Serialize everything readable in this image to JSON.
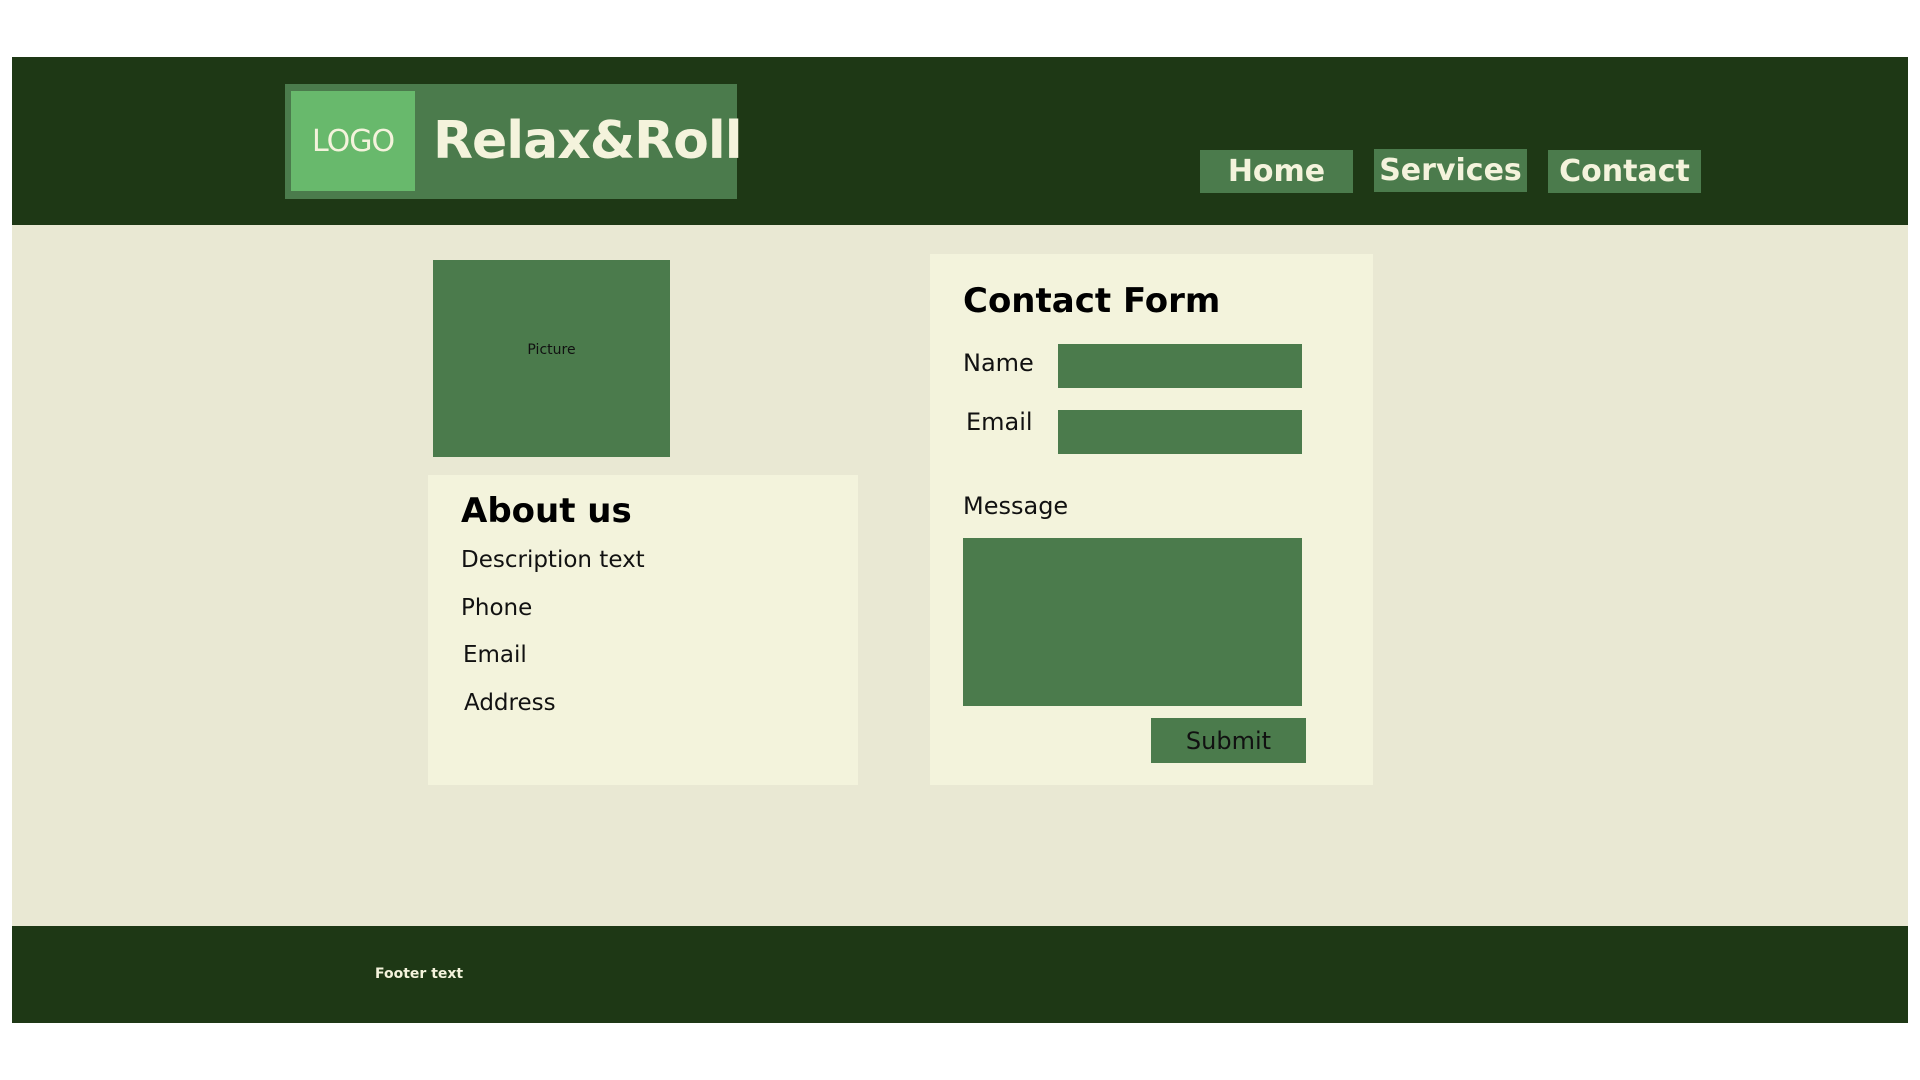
{
  "colors": {
    "header_bg": "#1e3815",
    "accent": "#4b7b4c",
    "logo_bg": "#68b96c",
    "page_bg": "#e9e8d3",
    "panel_bg": "#f3f3dc",
    "light_text": "#f4f3dc"
  },
  "header": {
    "logo_text": "LOGO",
    "brand_name": "Relax&Roll",
    "nav": [
      {
        "label": "Home"
      },
      {
        "label": "Services"
      },
      {
        "label": "Contact"
      }
    ]
  },
  "picture": {
    "label": "Picture"
  },
  "about": {
    "title": "About us",
    "description": "Description text",
    "phone": "Phone",
    "email": "Email",
    "address": "Address"
  },
  "contact_form": {
    "title": "Contact Form",
    "name_label": "Name",
    "name_value": "",
    "email_label": "Email",
    "email_value": "",
    "message_label": "Message",
    "message_value": "",
    "submit_label": "Submit"
  },
  "footer": {
    "text": "Footer text"
  }
}
